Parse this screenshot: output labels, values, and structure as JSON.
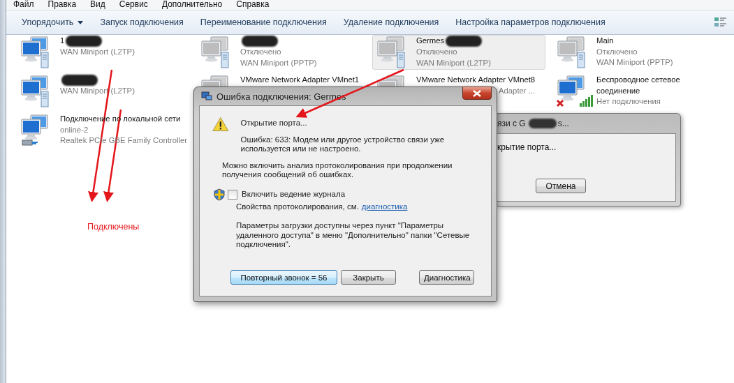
{
  "menu": [
    "Файл",
    "Правка",
    "Вид",
    "Сервис",
    "Дополнительно",
    "Справка"
  ],
  "toolbar": {
    "buttons": [
      {
        "label": "Упорядочить",
        "dropdown": true
      },
      {
        "label": "Запуск подключения",
        "dropdown": false
      },
      {
        "label": "Переименование подключения",
        "dropdown": false
      },
      {
        "label": "Удаление подключения",
        "dropdown": false
      },
      {
        "label": "Настройка параметров подключения",
        "dropdown": false
      }
    ]
  },
  "connections": [
    {
      "kind": "wan",
      "name": "1",
      "redacted": true,
      "enabled": true,
      "selected": false,
      "device": "WAN Miniport (L2TP)"
    },
    {
      "kind": "wan",
      "redacted": true,
      "enabled": false,
      "selected": false,
      "status": "Отключено",
      "device": "WAN Miniport (PPTP)"
    },
    {
      "kind": "wan",
      "name": "Germes",
      "redacted": true,
      "enabled": false,
      "selected": true,
      "status": "Отключено",
      "device": "WAN Miniport (L2TP)"
    },
    {
      "kind": "wan",
      "name": "Main",
      "enabled": false,
      "selected": false,
      "status": "Отключено",
      "device": "WAN Miniport (PPTP)"
    },
    {
      "kind": "wan",
      "redacted": true,
      "enabled": true,
      "selected": false,
      "device": "WAN Miniport (L2TP)"
    },
    {
      "kind": "vmware",
      "name": "VMware Network Adapter VMnet1",
      "selected": false
    },
    {
      "kind": "vmware",
      "name": "VMware Network Adapter VMnet8",
      "selected": false,
      "device": "Adapter ..."
    },
    {
      "kind": "wireless",
      "name": "Беспроводное сетевое соединение",
      "enabled": true,
      "selected": false,
      "status": "Нет подключения"
    },
    {
      "kind": "lan",
      "name": "Подключение по локальной сети",
      "enabled": true,
      "selected": false,
      "status": "online-2",
      "device": "Realtek PCIe GBE Family Controller"
    }
  ],
  "error_dialog": {
    "title": "Ошибка подключения: Germes",
    "progress": "Открытие порта...",
    "error": "Ошибка: 633: Модем или другое устройство связи уже используется или не настроено.",
    "hint": "Можно включить анализ протоколирования при продолжении получения сообщений об ошибках.",
    "log_checkbox": {
      "label": "Включить ведение журнала",
      "checked": false
    },
    "log_props": {
      "text": "Свойства протоколирования, см.",
      "link": "диагностика"
    },
    "note": "Параметры загрузки доступны через пункт \"Параметры удаленного доступа\" в меню \"Дополнительно\" папки \"Сетевые подключения\".",
    "buttons": [
      {
        "label": "Повторный звонок = 56",
        "default": true
      },
      {
        "label": "Закрыть",
        "default": false
      },
      {
        "label": "Диагностика",
        "default": false
      }
    ]
  },
  "connect_dialog": {
    "title": "язи с G",
    "title_tail": "s...",
    "message": "крытие порта...",
    "buttons": [
      "Отмена"
    ]
  },
  "annotation": {
    "text": "Подключены"
  }
}
